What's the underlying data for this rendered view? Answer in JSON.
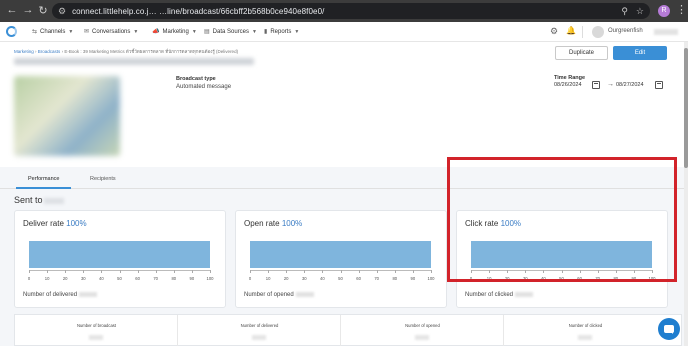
{
  "browser": {
    "url": "connect.littlehelp.co.j… …line/broadcast/66cbff2b568b0ce940e8f0e0/",
    "profile_initial": "R"
  },
  "nav": {
    "channels": "Channels",
    "conversations": "Conversations",
    "marketing": "Marketing",
    "data_sources": "Data Sources",
    "reports": "Reports",
    "user": "Ourgreenfish"
  },
  "header": {
    "breadcrumb_marketing": "Marketing",
    "breadcrumb_broadcasts": "Broadcasts",
    "breadcrumb_current": "E-Book : 39 Marketing Metrics ตัวชี้วัดผลการตลาด ที่นักการตลาดทุกคนต้องรู้ (Delivered)",
    "duplicate_label": "Duplicate",
    "edit_label": "Edit",
    "broadcast_type_label": "Broadcast type",
    "broadcast_type_value": "Automated message",
    "time_range_label": "Time Range",
    "date_from": "08/26/2024",
    "date_to": "08/27/2024"
  },
  "tabs": {
    "performance": "Performance",
    "recipients": "Recipients"
  },
  "sent_to_label": "Sent to",
  "cards": [
    {
      "title": "Deliver rate",
      "percent": "100%",
      "footer": "Number of delivered",
      "rate": 100
    },
    {
      "title": "Open rate",
      "percent": "100%",
      "footer": "Number of opened",
      "rate": 100
    },
    {
      "title": "Click rate",
      "percent": "100%",
      "footer": "Number of clicked",
      "rate": 100
    }
  ],
  "axis_ticks": [
    "0",
    "10",
    "20",
    "30",
    "40",
    "50",
    "60",
    "70",
    "80",
    "90",
    "100"
  ],
  "stats": {
    "broadcast": "Number of broadcast",
    "delivered": "Number of delivered",
    "opened": "Number of opened",
    "clicked": "Number of clicked"
  },
  "colors": {
    "accent": "#3a8fd6",
    "bar": "#7fb5dd",
    "highlight": "#d2232a"
  }
}
